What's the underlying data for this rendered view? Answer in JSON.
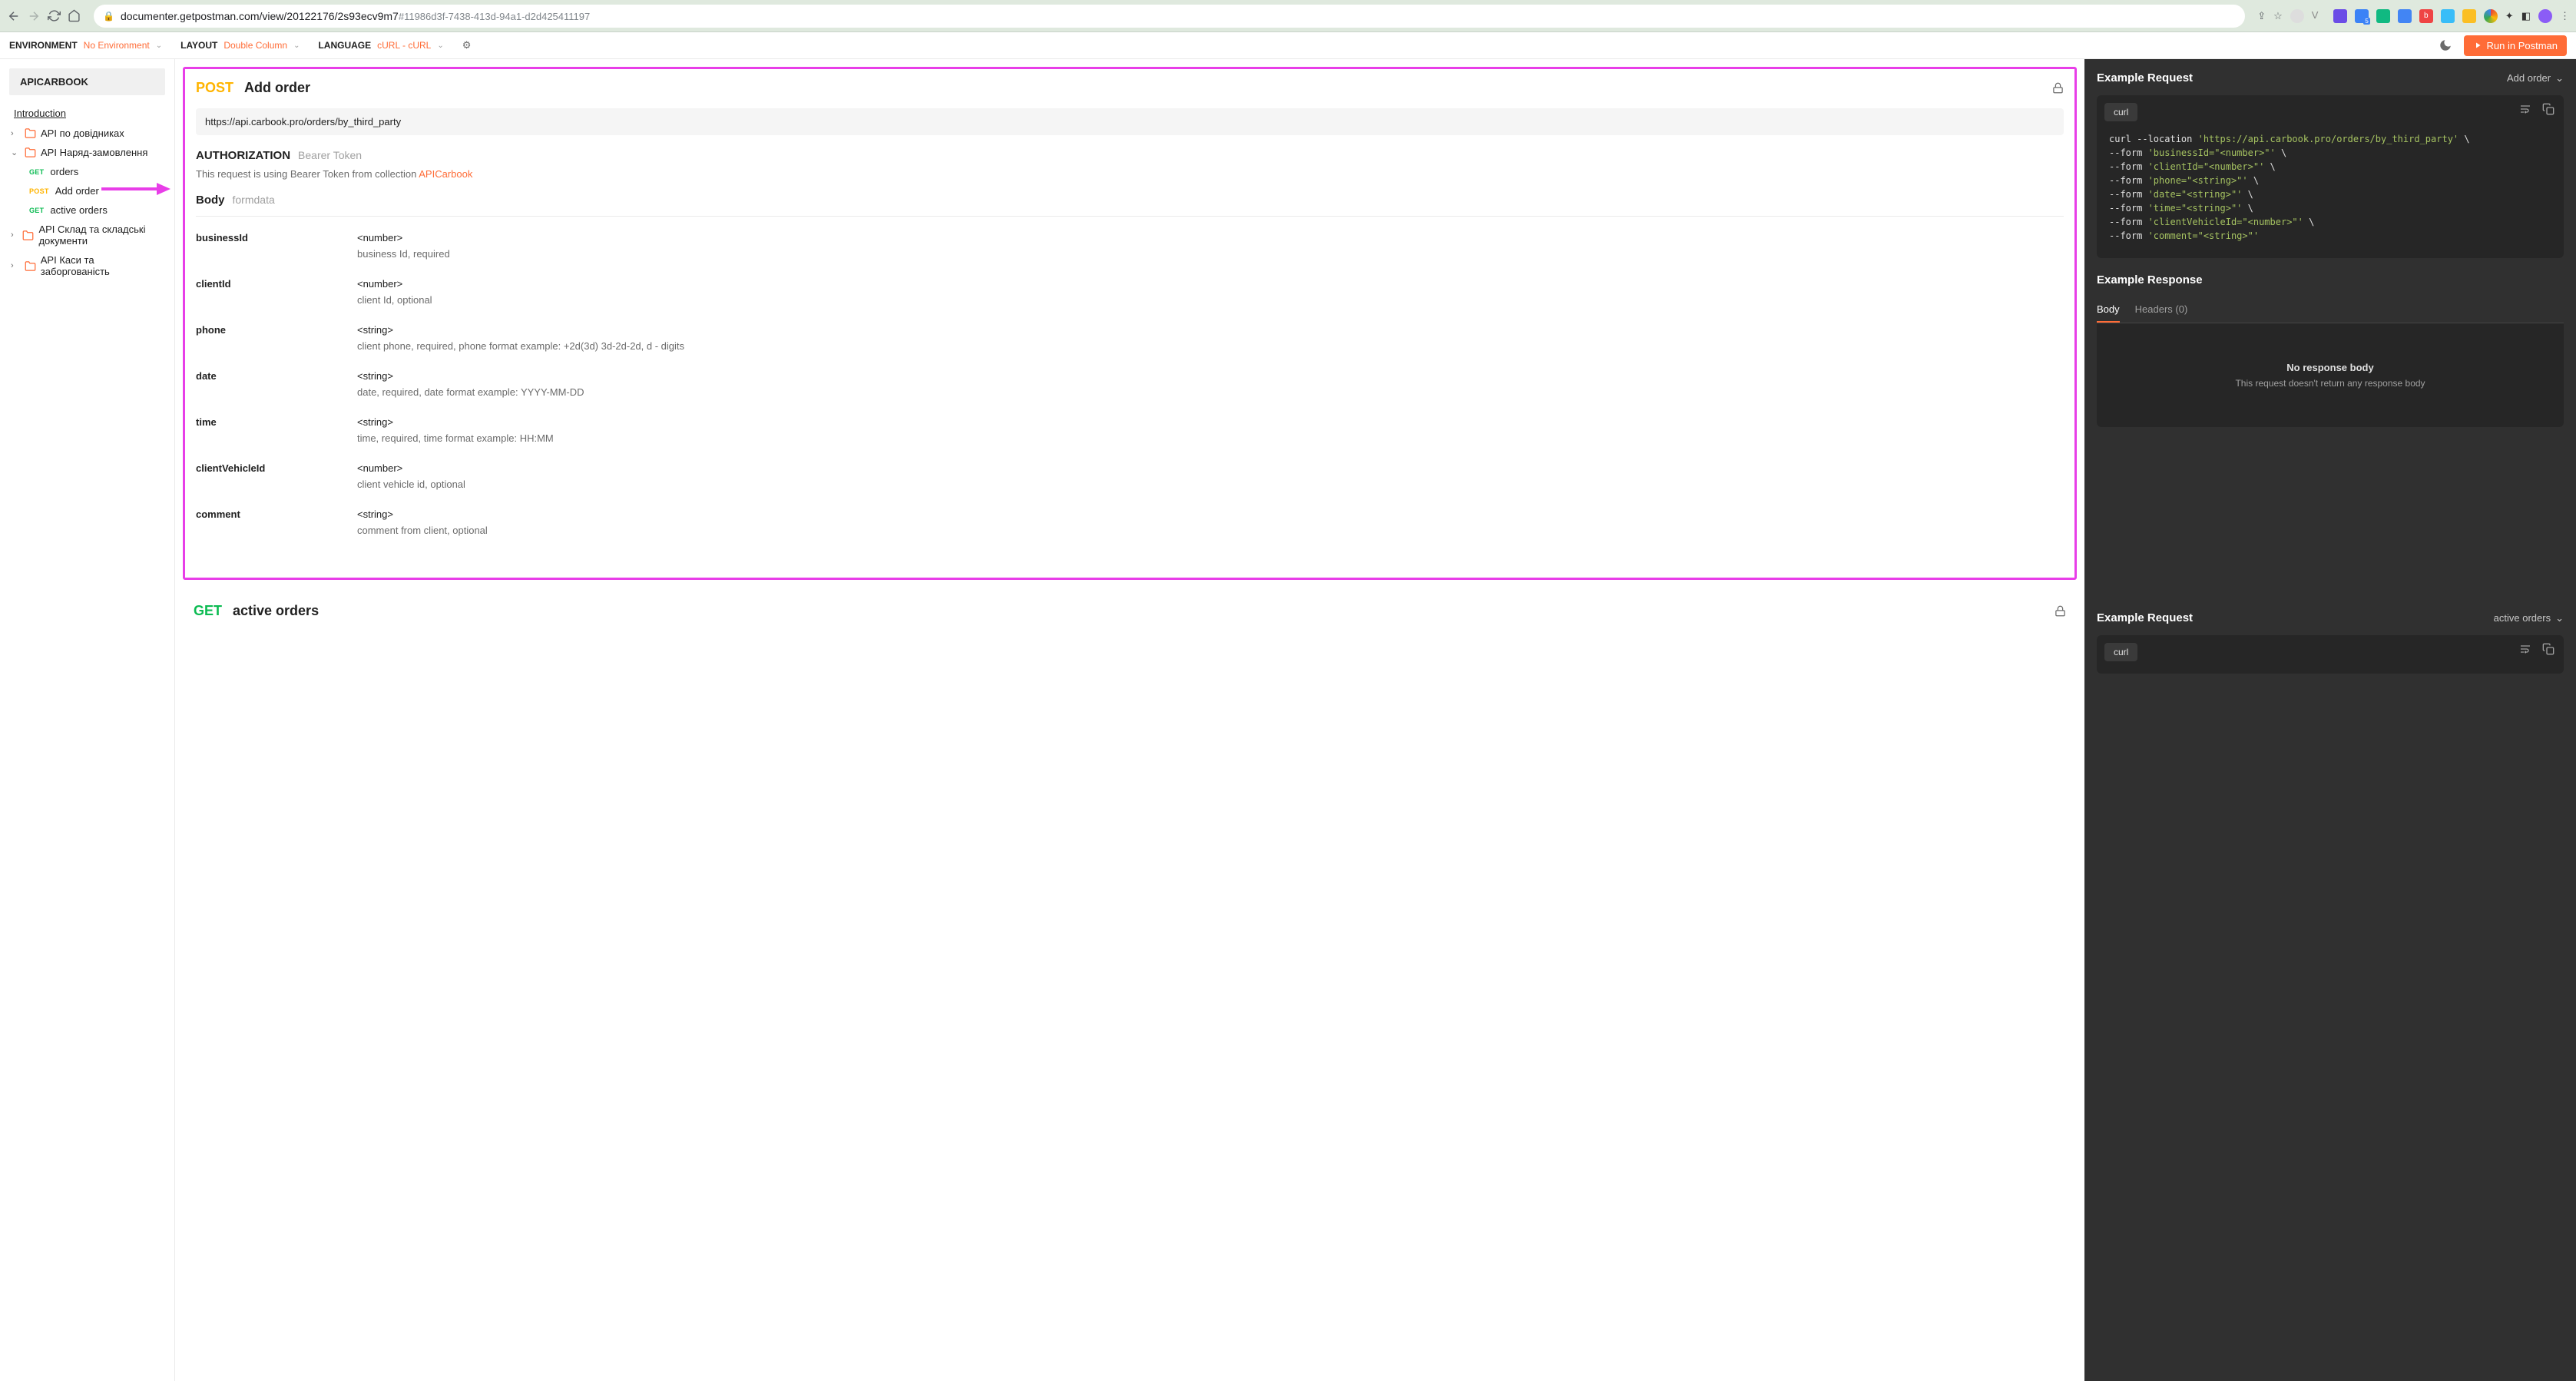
{
  "browser": {
    "url_host": "documenter.getpostman.com",
    "url_path": "/view/20122176/2s93ecv9m7",
    "url_hash": "#11986d3f-7438-413d-94a1-d2d425411197"
  },
  "topbar": {
    "env_label": "ENVIRONMENT",
    "env_value": "No Environment",
    "layout_label": "LAYOUT",
    "layout_value": "Double Column",
    "lang_label": "LANGUAGE",
    "lang_value": "cURL - cURL",
    "run_label": "Run in Postman"
  },
  "sidebar": {
    "title": "APICARBOOK",
    "intro": "Introduction",
    "folders": [
      {
        "name": "API по довідниках",
        "expanded": false
      },
      {
        "name": "API Наряд-замовлення",
        "expanded": true,
        "items": [
          {
            "method": "GET",
            "name": "orders"
          },
          {
            "method": "POST",
            "name": "Add order"
          },
          {
            "method": "GET",
            "name": "active orders"
          }
        ]
      },
      {
        "name": "API Склад та складські документи",
        "expanded": false
      },
      {
        "name": "API Каси та заборгованість",
        "expanded": false
      }
    ]
  },
  "doc": {
    "method": "POST",
    "title": "Add order",
    "url": "https://api.carbook.pro/orders/by_third_party",
    "auth_label": "AUTHORIZATION",
    "auth_type": "Bearer Token",
    "auth_desc_prefix": "This request is using Bearer Token from collection ",
    "auth_link": "APICarbook",
    "body_label": "Body",
    "body_type": "formdata",
    "params": [
      {
        "name": "businessId",
        "type": "<number>",
        "desc": "business Id, required"
      },
      {
        "name": "clientId",
        "type": "<number>",
        "desc": "client Id, optional"
      },
      {
        "name": "phone",
        "type": "<string>",
        "desc": "client phone, required, phone format example: +2d(3d) 3d-2d-2d, d - digits"
      },
      {
        "name": "date",
        "type": "<string>",
        "desc": "date, required, date format example: YYYY-MM-DD"
      },
      {
        "name": "time",
        "type": "<string>",
        "desc": "time, required, time format example: HH:MM"
      },
      {
        "name": "clientVehicleId",
        "type": "<number>",
        "desc": "client vehicle id, optional"
      },
      {
        "name": "comment",
        "type": "<string>",
        "desc": "comment from client, optional"
      }
    ]
  },
  "next": {
    "method": "GET",
    "title": "active orders"
  },
  "example": {
    "req_title": "Example Request",
    "req_selector": "Add order",
    "code_tab": "curl",
    "code_lines": [
      {
        "pre": "curl --location ",
        "str": "'https://api.carbook.pro/orders/by_third_party'",
        "post": " \\"
      },
      {
        "pre": "--form ",
        "str": "'businessId=\"<number>\"'",
        "post": " \\"
      },
      {
        "pre": "--form ",
        "str": "'clientId=\"<number>\"'",
        "post": " \\"
      },
      {
        "pre": "--form ",
        "str": "'phone=\"<string>\"'",
        "post": " \\"
      },
      {
        "pre": "--form ",
        "str": "'date=\"<string>\"'",
        "post": " \\"
      },
      {
        "pre": "--form ",
        "str": "'time=\"<string>\"'",
        "post": " \\"
      },
      {
        "pre": "--form ",
        "str": "'clientVehicleId=\"<number>\"'",
        "post": " \\"
      },
      {
        "pre": "--form ",
        "str": "'comment=\"<string>\"'",
        "post": ""
      }
    ],
    "resp_title": "Example Response",
    "resp_tabs": {
      "body": "Body",
      "headers": "Headers (0)"
    },
    "no_body_title": "No response body",
    "no_body_desc": "This request doesn't return any response body",
    "req2_selector": "active orders",
    "code_tab2": "curl"
  }
}
